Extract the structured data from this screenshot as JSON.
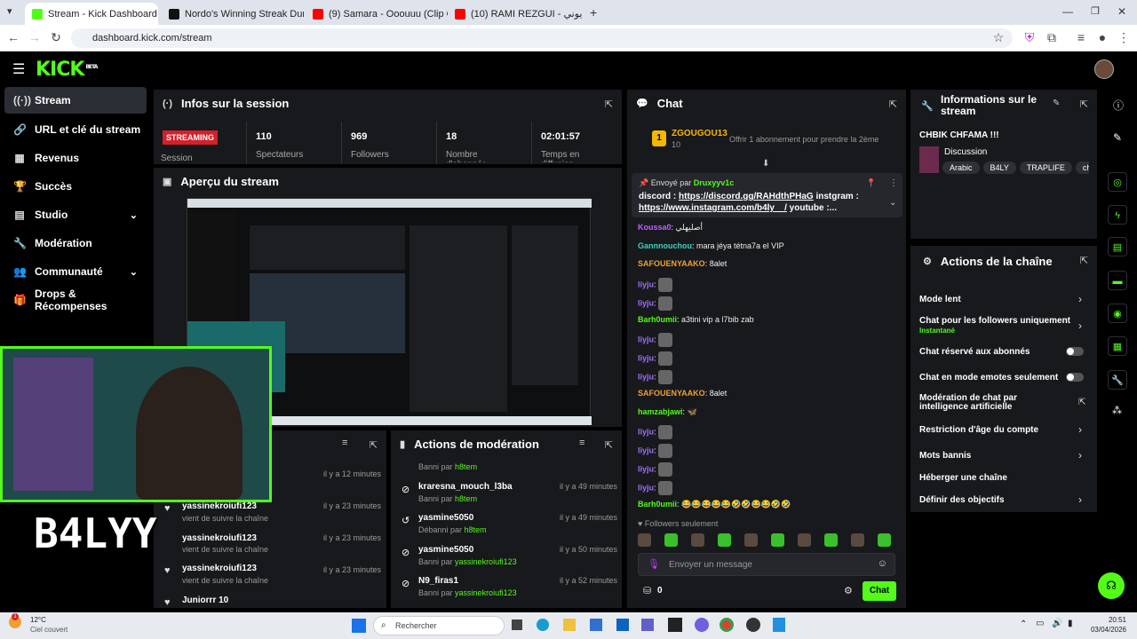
{
  "browser": {
    "tabs": [
      {
        "title": "Stream - Kick Dashboard",
        "color": "#53fc18"
      },
      {
        "title": "Nordo's Winning Streak During",
        "color": "#111111"
      },
      {
        "title": "(9) Samara - Ooouuu (Clip Offic",
        "color": "#ff0000"
      },
      {
        "title": "(10) RAMI REZGUI - تونسي . يوني",
        "color": "#ff0000"
      }
    ],
    "url": "dashboard.kick.com/stream"
  },
  "sidebar": {
    "items": [
      {
        "label": "Stream",
        "icon": "broadcast-icon"
      },
      {
        "label": "URL et clé du stream",
        "icon": "link-icon"
      },
      {
        "label": "Revenus",
        "icon": "chart-icon"
      },
      {
        "label": "Succès",
        "icon": "trophy-icon"
      },
      {
        "label": "Studio",
        "icon": "studio-icon"
      },
      {
        "label": "Modération",
        "icon": "wrench-icon"
      },
      {
        "label": "Communauté",
        "icon": "community-icon"
      },
      {
        "label": "Drops & Récompenses",
        "icon": "gift-icon"
      }
    ]
  },
  "session": {
    "title": "Infos sur la session",
    "status": "STREAMING",
    "status_label": "Session",
    "viewers": "110",
    "viewers_label": "Spectateurs",
    "followers": "969",
    "followers_label": "Followers",
    "subs": "18",
    "subs_label": "Nombre d'abonnés",
    "time": "02:01:57",
    "time_label": "Temps en diffusion"
  },
  "preview": {
    "title": "Aperçu du stream"
  },
  "overlay_text": "B4LYY",
  "activity": {
    "items": [
      {
        "user": "",
        "sub": "",
        "time": "il y a 12 minutes"
      },
      {
        "user": "",
        "sub": "",
        "time": "il y a 23 minutes"
      },
      {
        "user": "yassinekroiufi123",
        "sub": "vient de suivre la chaîne",
        "time": "il y a 23 minutes"
      },
      {
        "user": "yassinekroiufi123",
        "sub": "vient de suivre la chaîne",
        "time": "il y a 23 minutes"
      },
      {
        "user": "yassinekroiufi123",
        "sub": "vient de suivre la chaîne",
        "time": "il y a 23 minutes"
      },
      {
        "user": "Juniorrr 10",
        "sub": "",
        "time": "il y a 23 minutes"
      }
    ]
  },
  "modactions": {
    "title": "Actions de modération",
    "top": {
      "text": "Banni par",
      "by": "h8tem"
    },
    "items": [
      {
        "user": "kraresna_mouch_l3ba",
        "action": "Banni par",
        "by": "h8tem",
        "time": "il y a 49 minutes"
      },
      {
        "user": "yasmine5050",
        "action": "Débanni par",
        "by": "h8tem",
        "time": "il y a 49 minutes"
      },
      {
        "user": "yasmine5050",
        "action": "Banni par",
        "by": "yassinekroiufi123",
        "time": "il y a 50 minutes"
      },
      {
        "user": "N9_firas1",
        "action": "Banni par",
        "by": "yassinekroiufi123",
        "time": "il y a 52 minutes"
      }
    ]
  },
  "chat": {
    "title": "Chat",
    "gifter": "ZGOUGOU13",
    "gifter_count": "10",
    "gift_msg": "Offrir 1 abonnement pour prendre la 2ème",
    "pinned_by_label": "Envoyé par",
    "pinned_by": "Druxyyv1c",
    "pinned_prefix": "discord :",
    "pinned_link1": "https://discord.gg/RAHdthPHaG",
    "pinned_mid": "instgram :",
    "pinned_link2": "https://www.instagram.com/b4ly__/",
    "pinned_suffix": "youtube :...",
    "messages": [
      {
        "user": "Koussa0",
        "text": "أصليهلي",
        "color": "#c060ff"
      },
      {
        "user": "Gannnouchou",
        "text": "mara jéya tétna7a el VIP",
        "color": "#40d0c0"
      },
      {
        "user": "SAFOUENYAAKO",
        "text": "8alet",
        "color": "#f0a030"
      },
      {
        "user": "liyju",
        "text": "",
        "color": "#a070ff"
      },
      {
        "user": "liyju",
        "text": "",
        "color": "#a070ff"
      },
      {
        "user": "Barh0umii",
        "text": "a3tini vip a l7bib zab",
        "color": "#53fc18"
      },
      {
        "user": "liyju",
        "text": "",
        "color": "#a070ff"
      },
      {
        "user": "liyju",
        "text": "",
        "color": "#a070ff"
      },
      {
        "user": "liyju",
        "text": "",
        "color": "#a070ff"
      },
      {
        "user": "SAFOUENYAAKO",
        "text": "8alet",
        "color": "#f0a030"
      },
      {
        "user": "hamzabjawi",
        "text": "🦋",
        "color": "#53fc18"
      },
      {
        "user": "liyju",
        "text": "",
        "color": "#a070ff"
      },
      {
        "user": "liyju",
        "text": "",
        "color": "#a070ff"
      },
      {
        "user": "liyju",
        "text": "",
        "color": "#a070ff"
      },
      {
        "user": "liyju",
        "text": "",
        "color": "#a070ff"
      },
      {
        "user": "Barh0umii",
        "text": "😂😂😂😂😂🤣🤣😂😂🤣🤣",
        "color": "#53fc18"
      }
    ],
    "followers_only": "Followers seulement",
    "input_placeholder": "Envoyer un message",
    "points": "0",
    "send_label": "Chat"
  },
  "streaminfo": {
    "title": "Informations sur le stream",
    "stream_title": "CHBIK CHFAMA !!!",
    "category": "Discussion",
    "tags": [
      "Arabic",
      "B4LY",
      "TRAPLIFE",
      "chi"
    ]
  },
  "channelactions": {
    "title": "Actions de la chaîne",
    "items": [
      {
        "label": "Mode lent",
        "sub": ""
      },
      {
        "label": "Chat pour les followers uniquement",
        "sub": "Instantané"
      },
      {
        "label": "Chat réservé aux abonnés",
        "sub": ""
      },
      {
        "label": "Chat en mode emotes seulement",
        "sub": ""
      },
      {
        "label": "Modération de chat par intelligence artificielle",
        "sub": ""
      },
      {
        "label": "Restriction d'âge du compte",
        "sub": ""
      },
      {
        "label": "Mots bannis",
        "sub": ""
      },
      {
        "label": "Héberger une chaîne",
        "sub": ""
      },
      {
        "label": "Définir des objectifs",
        "sub": ""
      }
    ]
  },
  "taskbar": {
    "weather_temp": "12°C",
    "weather_desc": "Ciel couvert",
    "search_placeholder": "Rechercher",
    "time": "20:51",
    "date": "03/04/2026"
  },
  "colors": {
    "accent": "#53fc18",
    "panel": "#18191c",
    "streaming": "#d4202a"
  }
}
